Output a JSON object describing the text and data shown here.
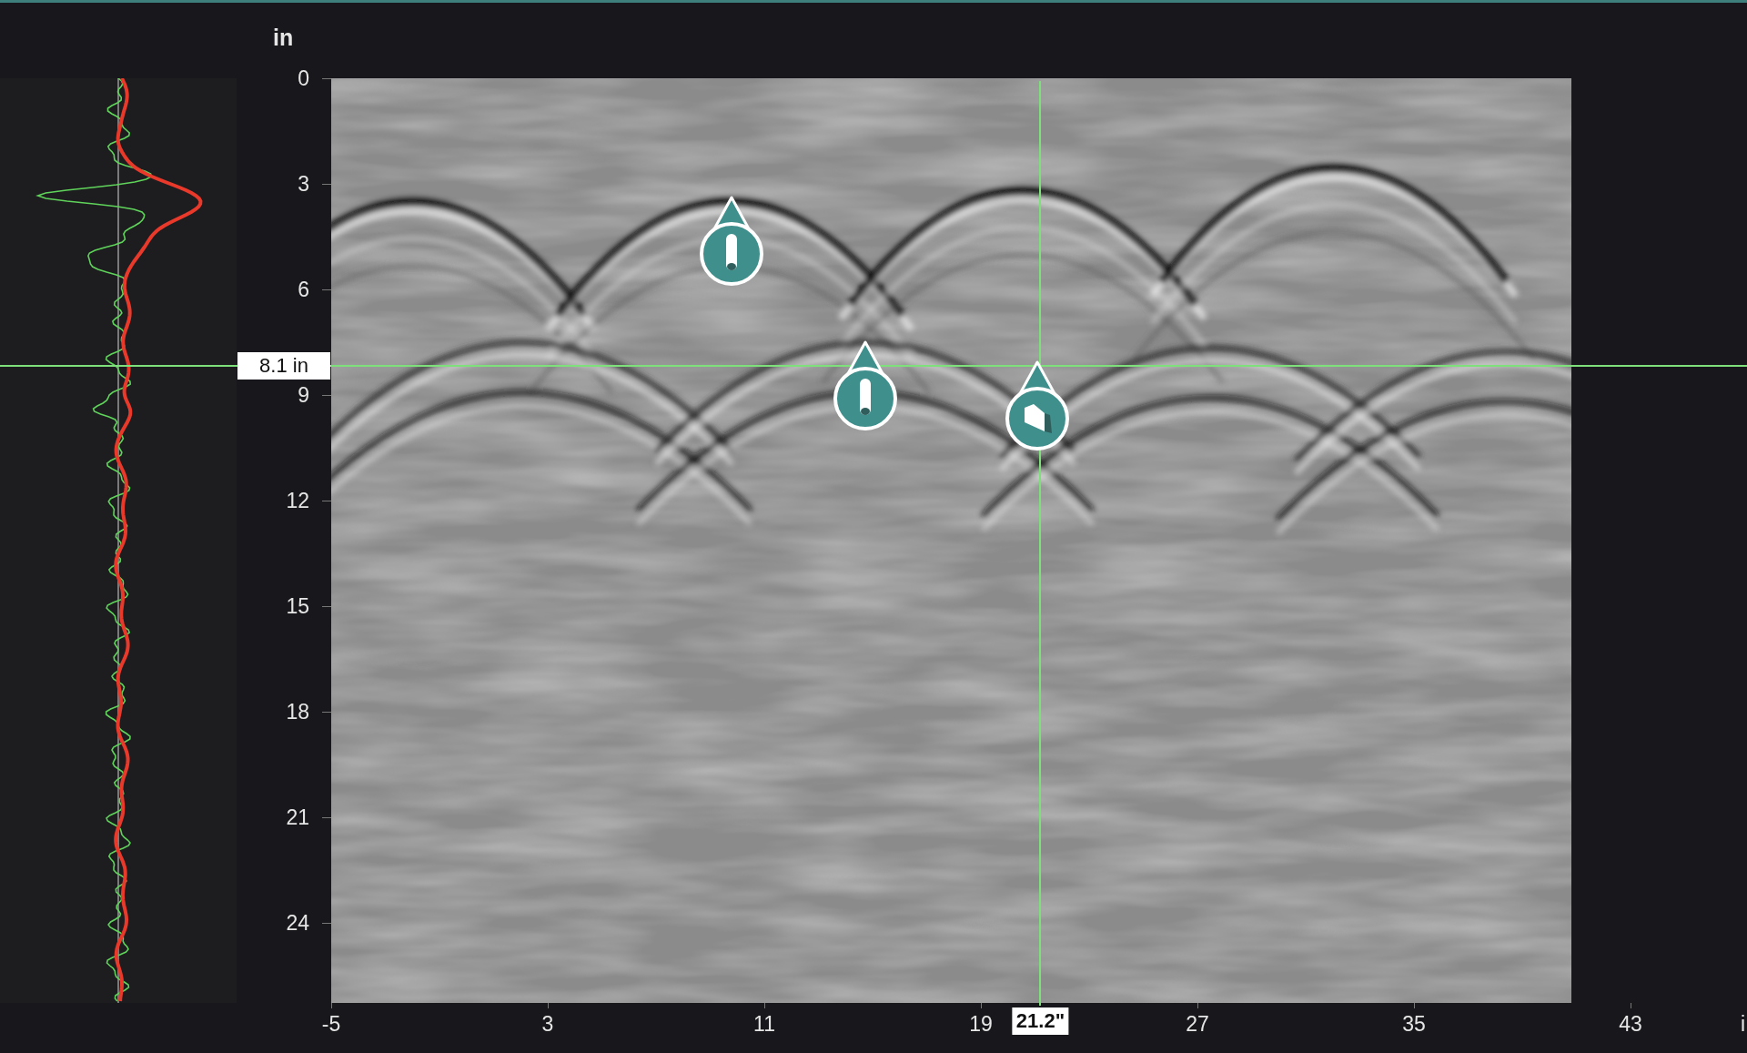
{
  "depth_axis": {
    "unit": "in",
    "ticks": [
      "0",
      "3",
      "6",
      "9",
      "12",
      "15",
      "18",
      "21",
      "24"
    ]
  },
  "radargram": {
    "markers": [
      {
        "kind": "cylinder"
      },
      {
        "kind": "cylinder"
      },
      {
        "kind": "block"
      }
    ]
  },
  "cursor": {
    "depth_label": "8.1 in",
    "position_label": "21.2\""
  },
  "position_axis": {
    "ticks": [
      "-5",
      "3",
      "11",
      "19",
      "27",
      "35",
      "43"
    ],
    "unit": "i"
  }
}
